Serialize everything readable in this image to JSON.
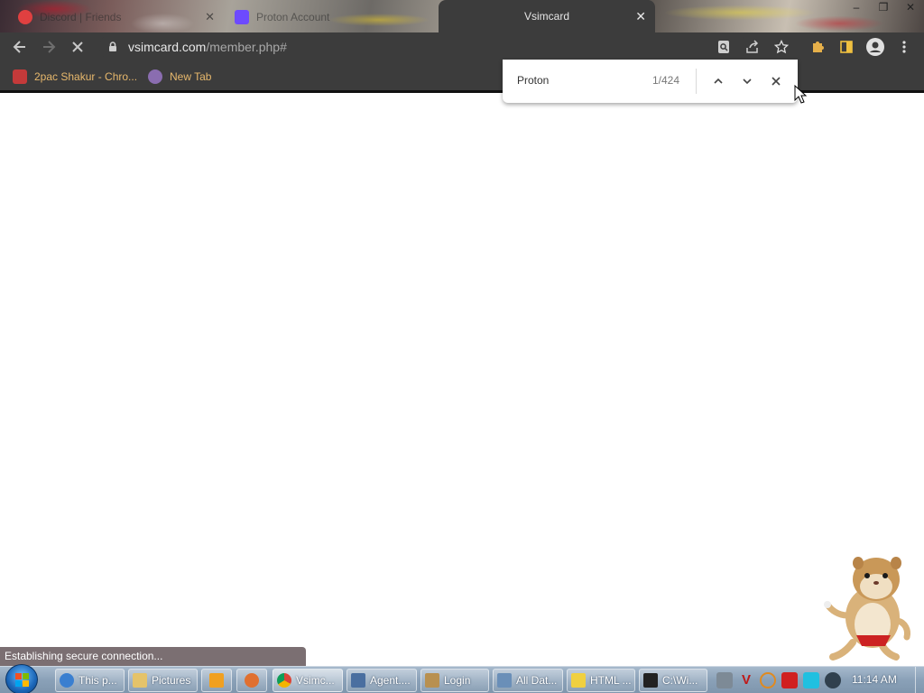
{
  "tabs": [
    {
      "title": "Discord | Friends",
      "favicon_color": "#e04040",
      "active": false
    },
    {
      "title": "Proton Account",
      "favicon_color": "#6d4aff",
      "active": false
    },
    {
      "title": "Vsimcard",
      "active": true
    }
  ],
  "toolbar": {
    "url_host": "vsimcard.com",
    "url_path": "/member.php#"
  },
  "bookmarks": [
    {
      "label": "2pac Shakur - Chro...",
      "icon_color": "#c43a3a"
    },
    {
      "label": "New Tab",
      "icon_color": "#8a6db0"
    }
  ],
  "find_bar": {
    "query": "Proton",
    "count": "1/424"
  },
  "status_bar": {
    "text": "Establishing secure connection..."
  },
  "taskbar": {
    "items": [
      {
        "label": "This p...",
        "icon_color": "#3a7fd0",
        "icon": "ie-icon"
      },
      {
        "label": "Pictures",
        "icon_color": "#e5c36a",
        "icon": "folder-icon"
      },
      {
        "label": "",
        "icon_color": "#f0a020",
        "icon": "media-player-icon"
      },
      {
        "label": "",
        "icon_color": "#e07030",
        "icon": "app-icon"
      },
      {
        "label": "Vsimc...",
        "icon_color": "#db4437",
        "icon": "chrome-icon",
        "active": true
      },
      {
        "label": "Agent....",
        "icon_color": "#4a6fa0",
        "icon": "window-icon"
      },
      {
        "label": "Login",
        "icon_color": "#b89050",
        "icon": "login-icon"
      },
      {
        "label": "All Dat...",
        "icon_color": "#6a8fb8",
        "icon": "window-icon"
      },
      {
        "label": "HTML ...",
        "icon_color": "#f0d040",
        "icon": "help-icon"
      },
      {
        "label": "C:\\Wi...",
        "icon_color": "#222222",
        "icon": "7zip-icon"
      }
    ],
    "clock": "11:14 AM"
  },
  "colors": {
    "chrome_dark": "#3c3c3c",
    "bookmark_text": "#e7b86c",
    "status_bg": "#7b6f72"
  }
}
